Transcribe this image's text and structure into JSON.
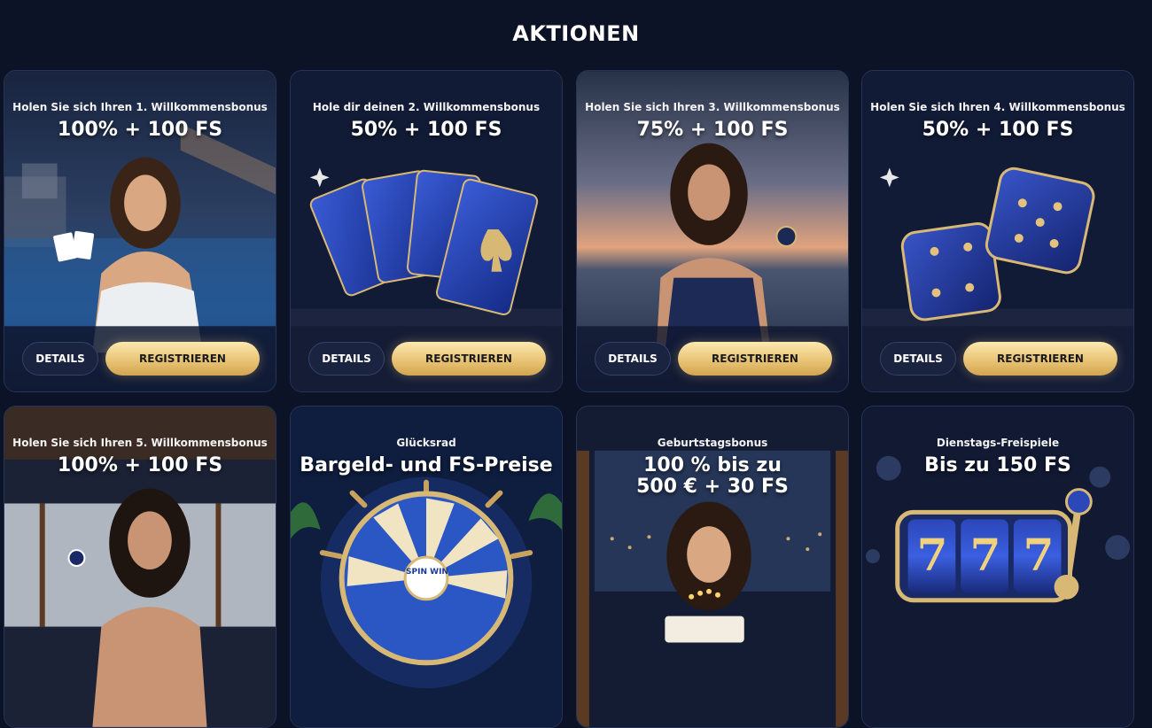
{
  "page": {
    "title": "AKTIONEN"
  },
  "buttons": {
    "details": "DETAILS",
    "register": "REGISTRIEREN"
  },
  "cards": [
    {
      "subtitle": "Holen Sie sich Ihren 1. Willkommensbonus",
      "headline": "100% + 100 FS",
      "art": "woman-holding-playing-cards"
    },
    {
      "subtitle": "Hole dir deinen 2. Willkommensbonus",
      "headline": "50% + 100 FS",
      "art": "blue-ace-cards"
    },
    {
      "subtitle": "Holen Sie sich Ihren 3. Willkommensbonus",
      "headline": "75% + 100 FS",
      "art": "woman-holding-compass"
    },
    {
      "subtitle": "Holen Sie sich Ihren 4. Willkommensbonus",
      "headline": "50% + 100 FS",
      "art": "blue-dice"
    },
    {
      "subtitle": "Holen Sie sich Ihren 5. Willkommensbonus",
      "headline": "100% + 100 FS",
      "art": "woman-holding-chip"
    },
    {
      "subtitle": "Glücksrad",
      "headline": "Bargeld- und FS-Preise",
      "art": "spin-win-wheel",
      "wheel_label": "SPIN WIN"
    },
    {
      "subtitle": "Geburtstagsbonus",
      "headline": "100 % bis zu\n500 € + 30 FS",
      "art": "woman-birthday-cake"
    },
    {
      "subtitle": "Dienstags-Freispiele",
      "headline": "Bis zu 150 FS",
      "art": "slot-machine-777",
      "reel_symbols": [
        "7",
        "7",
        "7"
      ]
    }
  ]
}
